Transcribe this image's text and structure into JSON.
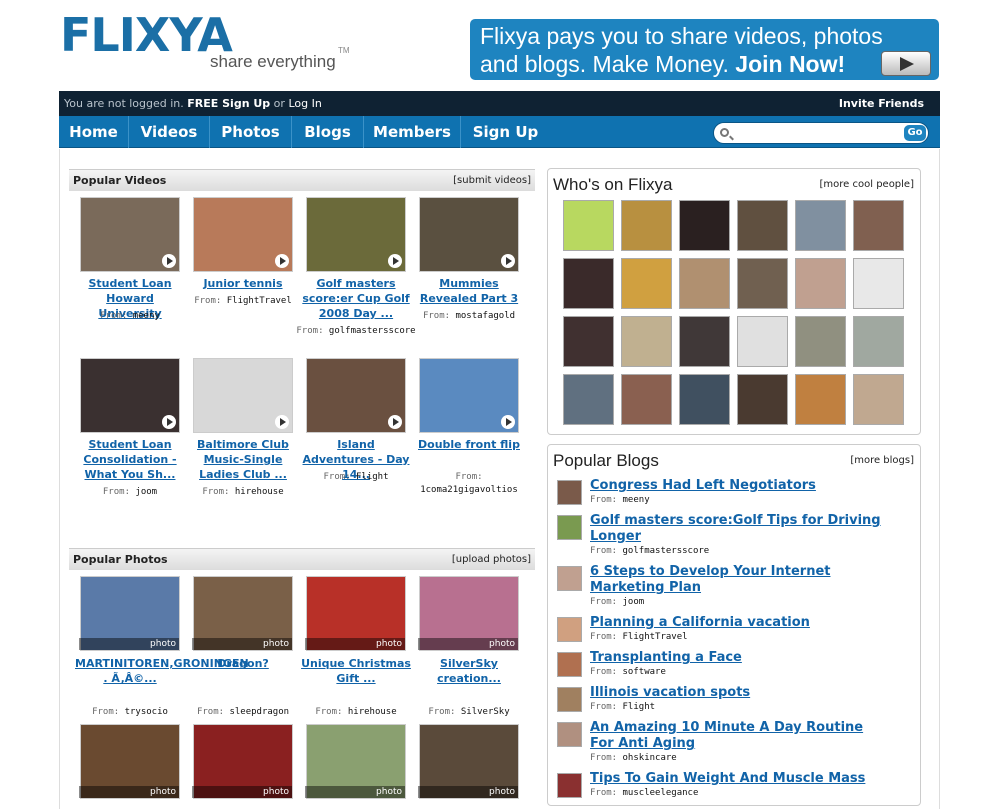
{
  "header": {
    "logo_text": "FLIXYA",
    "logo_tagline": "share everything",
    "logo_tm": "TM",
    "banner_line1": "Flixya pays you to share videos, photos",
    "banner_line2": "and blogs. Make Money.",
    "banner_cta": "Join Now!"
  },
  "topbar": {
    "status_prefix": "You are not logged in.",
    "signup": "FREE Sign Up",
    "or": "or",
    "login": "Log In",
    "invite": "Invite Friends"
  },
  "nav": {
    "items": [
      "Home",
      "Videos",
      "Photos",
      "Blogs",
      "Members",
      "Sign Up"
    ],
    "search_placeholder": "",
    "go": "Go"
  },
  "videos": {
    "title": "Popular Videos",
    "link": "[submit videos]",
    "from_label": "From:",
    "items": [
      {
        "title": "Student Loan Howard University",
        "user": "meeny",
        "color": "#7a6a5a"
      },
      {
        "title": "Junior tennis",
        "user": "FlightTravel",
        "color": "#b87a5a"
      },
      {
        "title": "Golf masters score:er Cup Golf 2008 Day ...",
        "user": "golfmastersscore",
        "color": "#6b6a3a"
      },
      {
        "title": "Mummies Revealed Part 3",
        "user": "mostafagold",
        "color": "#5a5040"
      },
      {
        "title": "Student Loan Consolidation - What You Sh...",
        "user": "joom",
        "color": "#3a3030"
      },
      {
        "title": "Baltimore Club Music-Single Ladies Club ...",
        "user": "hirehouse",
        "color": "#d8d8d8"
      },
      {
        "title": "Island Adventures - Day 14...",
        "user": "Flight",
        "color": "#6a5040"
      },
      {
        "title": "Double front flip",
        "user": "1coma21gigavoltios",
        "color": "#5a8ac0"
      }
    ]
  },
  "photos": {
    "title": "Popular Photos",
    "link": "[upload photos]",
    "from_label": "From:",
    "badge": "photo",
    "items": [
      {
        "title": "MARTINITOREN,GRONINGEN . Ã‚Â©...",
        "user": "trysocio",
        "color": "#5a7aa8"
      },
      {
        "title": "Dragon?",
        "user": "sleepdragon",
        "color": "#7a6048"
      },
      {
        "title": "Unique Christmas Gift ...",
        "user": "hirehouse",
        "color": "#b83028"
      },
      {
        "title": "SilverSky creation...",
        "user": "SilverSky",
        "color": "#b87090"
      },
      {
        "title": "",
        "user": "",
        "color": "#6a4a30"
      },
      {
        "title": "",
        "user": "",
        "color": "#8a2020"
      },
      {
        "title": "",
        "user": "",
        "color": "#8aa070"
      },
      {
        "title": "",
        "user": "",
        "color": "#5a4a3a"
      }
    ]
  },
  "who": {
    "title": "Who's on Flixya",
    "link": "[more cool people]",
    "colors": [
      "#b8d860",
      "#b89040",
      "#2a2020",
      "#605040",
      "#8090a0",
      "#806050",
      "#3a2a2a",
      "#d0a040",
      "#b09070",
      "#706050",
      "#c0a090",
      "#e8e8e8",
      "#403030",
      "#c0b090",
      "#403838",
      "#e0e0e0",
      "#909080",
      "#a0a8a0",
      "#607080",
      "#8a6050",
      "#405060",
      "#4a3a30",
      "#c08040",
      "#c0a890"
    ]
  },
  "blogs": {
    "title": "Popular Blogs",
    "link": "[more blogs]",
    "from_label": "From:",
    "items": [
      {
        "title": "Congress Had Left Negotiators",
        "user": "meeny",
        "color": "#7a5a4a"
      },
      {
        "title": "Golf masters score:Golf Tips for Driving Longer",
        "user": "golfmastersscore",
        "color": "#7a9a50"
      },
      {
        "title": "6 Steps to Develop Your Internet Marketing Plan",
        "user": "joom",
        "color": "#c0a090"
      },
      {
        "title": "Planning a California vacation",
        "user": "FlightTravel",
        "color": "#d0a080"
      },
      {
        "title": "Transplanting a Face",
        "user": "software",
        "color": "#b07050"
      },
      {
        "title": "Illinois vacation spots",
        "user": "Flight",
        "color": "#a08060"
      },
      {
        "title": "An Amazing 10 Minute A Day Routine For Anti Aging",
        "user": "ohskincare",
        "color": "#b09080"
      },
      {
        "title": "Tips To Gain Weight And Muscle Mass",
        "user": "muscleelegance",
        "color": "#8a3030"
      }
    ]
  }
}
